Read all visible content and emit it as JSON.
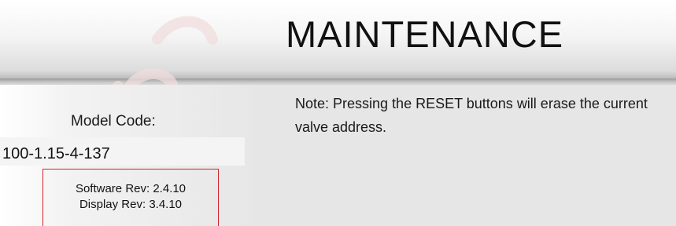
{
  "header": {
    "title": "MAINTENANCE"
  },
  "info": {
    "model_label": "Model Code:",
    "model_value": "100-1.15-4-137",
    "software_rev": "Software Rev: 2.4.10",
    "display_rev": "Display Rev: 3.4.10"
  },
  "note": {
    "text": "Note: Pressing the RESET buttons will erase the current valve address."
  },
  "colors": {
    "rev_box_border": "#d3222a",
    "panel_background": "#e6e6e6",
    "text": "#1a1a1a"
  }
}
